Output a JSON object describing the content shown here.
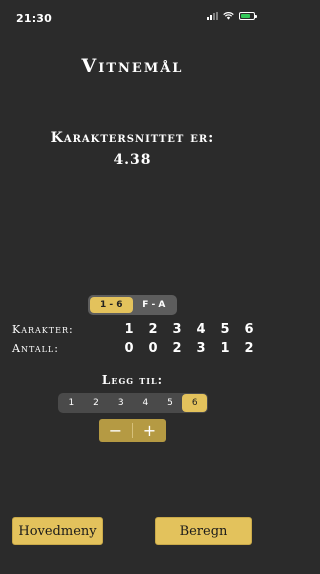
{
  "status": {
    "time": "21:30"
  },
  "title": "Vitnemål",
  "average": {
    "label": "Karaktersnittet er:",
    "value": "4.38"
  },
  "scale_toggle": {
    "options": [
      "1 - 6",
      "F - A"
    ],
    "selected": "1 - 6"
  },
  "grades": {
    "label": "Karakter:",
    "values": [
      "1",
      "2",
      "3",
      "4",
      "5",
      "6"
    ]
  },
  "counts": {
    "label": "Antall:",
    "values": [
      "0",
      "0",
      "2",
      "3",
      "1",
      "2"
    ]
  },
  "add": {
    "label": "Legg til:",
    "options": [
      "1",
      "2",
      "3",
      "4",
      "5",
      "6"
    ],
    "selected": "6",
    "minus": "−",
    "plus": "+"
  },
  "buttons": {
    "menu": "Hovedmeny",
    "calculate": "Beregn"
  },
  "colors": {
    "accent": "#e3c25c",
    "background": "#2b2b2b"
  }
}
